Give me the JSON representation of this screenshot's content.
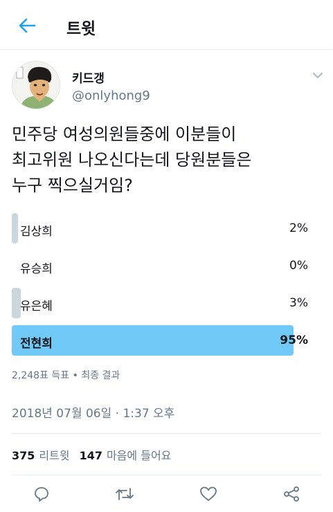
{
  "header": {
    "back_icon": "arrow-left-icon",
    "title": "트윗",
    "accent_color": "#1da1f2"
  },
  "author": {
    "name": "키드갱",
    "handle": "@onlyhong9",
    "avatar_icon": "avatar-illustration",
    "menu_icon": "chevron-down-icon"
  },
  "tweet": {
    "lines": [
      "민주당 여성의원들중에 이분들이",
      "최고위원 나오신다는데 당원분들은",
      "누구 찍으실거임?"
    ]
  },
  "poll": {
    "options": [
      {
        "label": "김상희",
        "percent_text": "2%",
        "percent": 2,
        "winner": false
      },
      {
        "label": "유승희",
        "percent_text": "0%",
        "percent": 0,
        "winner": false
      },
      {
        "label": "유은혜",
        "percent_text": "3%",
        "percent": 3,
        "winner": false
      },
      {
        "label": "전현희",
        "percent_text": "95%",
        "percent": 95,
        "winner": true
      }
    ],
    "bar_color": "#ccd6dd",
    "winner_color": "#71c9f8",
    "meta": "2,248표 득표 • 최종 결과"
  },
  "timestamp": "2018년 07월 06일 · 1:37 오후",
  "stats": {
    "retweets_count": "375",
    "retweets_label": "리트윗",
    "likes_count": "147",
    "likes_label": "마음에 들어요"
  },
  "actions": {
    "reply_icon": "reply-icon",
    "retweet_icon": "retweet-icon",
    "like_icon": "heart-icon",
    "share_icon": "share-icon"
  }
}
